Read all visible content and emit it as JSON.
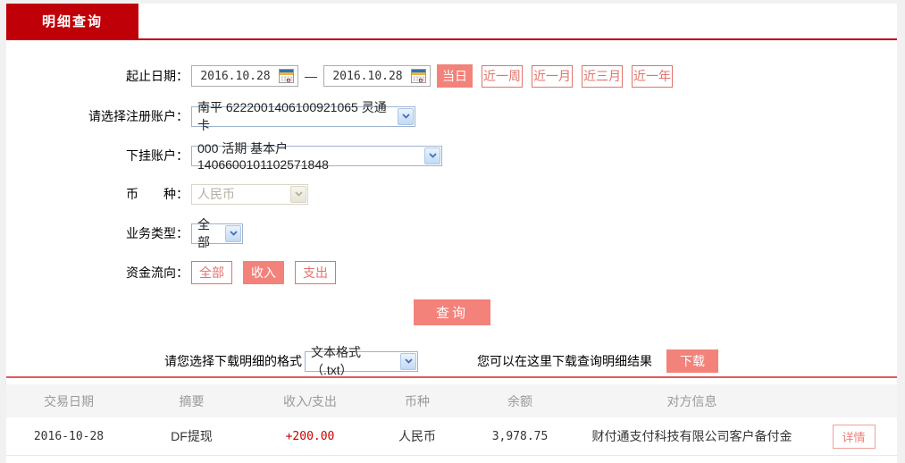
{
  "tab": {
    "label": "明细查询"
  },
  "form": {
    "date_range": {
      "label": "起止日期：",
      "start_value": "2016.10.28",
      "end_value": "2016.10.28",
      "separator": "—",
      "quick_buttons": [
        {
          "label": "当日",
          "active": true
        },
        {
          "label": "近一周",
          "active": false
        },
        {
          "label": "近一月",
          "active": false
        },
        {
          "label": "近三月",
          "active": false
        },
        {
          "label": "近一年",
          "active": false
        }
      ]
    },
    "register_account": {
      "label": "请选择注册账户：",
      "value": "南平 6222001406100921065 灵通卡"
    },
    "sub_account": {
      "label": "下挂账户：",
      "value": "000 活期 基本户 1406600101102571848"
    },
    "currency": {
      "label": "币　　种：",
      "value": "人民币",
      "disabled": true
    },
    "business_type": {
      "label": "业务类型：",
      "value": "全部"
    },
    "fund_flow": {
      "label": "资金流向：",
      "options": [
        {
          "label": "全部",
          "active": false
        },
        {
          "label": "收入",
          "active": true
        },
        {
          "label": "支出",
          "active": false
        }
      ]
    },
    "query_button": "查询"
  },
  "download": {
    "format_label": "请您选择下载明细的格式",
    "format_value": "文本格式（.txt）",
    "hint_label": "您可以在这里下载查询明细结果",
    "button_label": "下载"
  },
  "table": {
    "headers": [
      "交易日期",
      "摘要",
      "收入/支出",
      "币种",
      "余额",
      "对方信息"
    ],
    "rows": [
      {
        "date": "2016-10-28",
        "summary": "DF提现",
        "amount": "+200.00",
        "currency": "人民币",
        "balance": "3,978.75",
        "counterparty": "财付通支付科技有限公司客户备付金",
        "action": "详情"
      }
    ]
  },
  "icons": {
    "date_picker": "calendar-icon",
    "select_arrow": "chevron-down-icon"
  },
  "colors": {
    "tab_red": "#c00008",
    "accent_salmon": "#f2827a",
    "outline_salmon": "#e2736b",
    "amount_red": "#cc0000",
    "separator_pink": "#e05b5b",
    "header_gray": "#9a9a9a",
    "page_background": "#f1f1f1"
  }
}
